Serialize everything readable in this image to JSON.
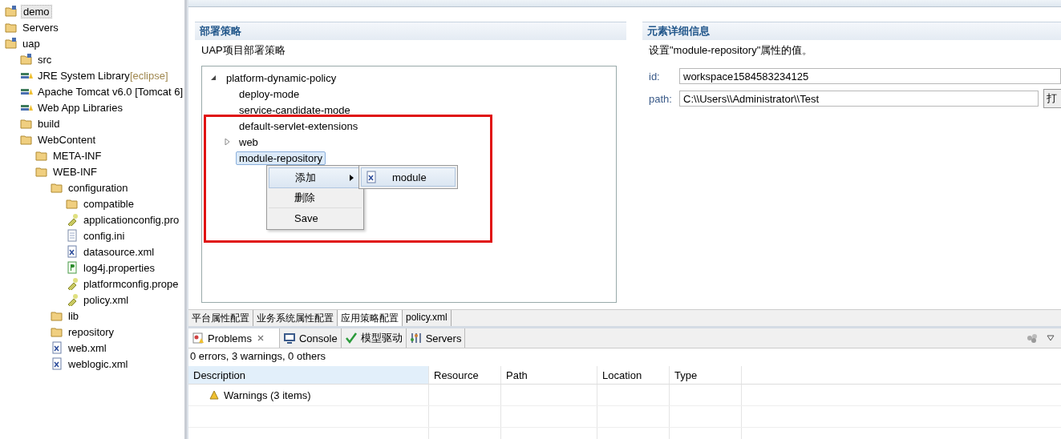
{
  "project_explorer": {
    "items": [
      {
        "label": "demo",
        "kind": "project",
        "selected": true
      },
      {
        "label": "Servers",
        "kind": "folder",
        "selected": false
      },
      {
        "label": "uap",
        "kind": "project",
        "selected": false,
        "children": [
          {
            "label": "src",
            "kind": "package",
            "selected": false
          },
          {
            "label": "JRE System Library",
            "decoration": "[eclipse]",
            "kind": "library",
            "selected": false
          },
          {
            "label": "Apache Tomcat v6.0 [Tomcat 6]",
            "kind": "library",
            "selected": false
          },
          {
            "label": "Web App Libraries",
            "kind": "library",
            "selected": false
          },
          {
            "label": "build",
            "kind": "folder",
            "selected": false
          },
          {
            "label": "WebContent",
            "kind": "folder",
            "selected": false,
            "children": [
              {
                "label": "META-INF",
                "kind": "folder",
                "selected": false
              },
              {
                "label": "WEB-INF",
                "kind": "folder",
                "selected": false,
                "children": [
                  {
                    "label": "configuration",
                    "kind": "folder",
                    "selected": false,
                    "children": [
                      {
                        "label": "compatible",
                        "kind": "folder",
                        "selected": false
                      },
                      {
                        "label": "applicationconfig.pro",
                        "kind": "config",
                        "selected": false
                      },
                      {
                        "label": "config.ini",
                        "kind": "file",
                        "selected": false
                      },
                      {
                        "label": "datasource.xml",
                        "kind": "xml",
                        "selected": false
                      },
                      {
                        "label": "log4j.properties",
                        "kind": "properties",
                        "selected": false
                      },
                      {
                        "label": "platformconfig.prope",
                        "kind": "config",
                        "selected": false
                      },
                      {
                        "label": "policy.xml",
                        "kind": "config",
                        "selected": false
                      }
                    ]
                  },
                  {
                    "label": "lib",
                    "kind": "folder",
                    "selected": false
                  },
                  {
                    "label": "repository",
                    "kind": "folder",
                    "selected": false
                  },
                  {
                    "label": "web.xml",
                    "kind": "xml",
                    "selected": false
                  },
                  {
                    "label": "weblogic.xml",
                    "kind": "xml",
                    "selected": false
                  }
                ]
              }
            ]
          }
        ]
      }
    ]
  },
  "deploy_section": {
    "title": "部署策略",
    "description": "UAP项目部署策略",
    "tree": [
      {
        "label": "platform-dynamic-policy",
        "expanded": true,
        "selected": false,
        "children": [
          {
            "label": "deploy-mode",
            "selected": false
          },
          {
            "label": "service-candidate-mode",
            "selected": false
          },
          {
            "label": "default-servlet-extensions",
            "selected": false
          },
          {
            "label": "web",
            "expanded": false,
            "selected": false
          },
          {
            "label": "module-repository",
            "selected": true
          }
        ]
      }
    ]
  },
  "context_menu": {
    "items": [
      {
        "label": "添加",
        "submenu": true,
        "selected": true
      },
      {
        "label": "删除",
        "submenu": false,
        "selected": false
      },
      {
        "label": "Save",
        "submenu": false,
        "selected": false
      }
    ],
    "submenu": [
      {
        "label": "module"
      }
    ]
  },
  "details_section": {
    "title": "元素详细信息",
    "description": "设置\"module-repository\"属性的值。",
    "fields": [
      {
        "label": "id:",
        "value": "workspace1584583234125"
      },
      {
        "label": "path:",
        "value": "C:\\\\Users\\\\Administrator\\\\Test",
        "button": "打"
      }
    ]
  },
  "editor_tabs": [
    {
      "label": "平台属性配置",
      "selected": false
    },
    {
      "label": "业务系统属性配置",
      "selected": false
    },
    {
      "label": "应用策略配置",
      "selected": true
    },
    {
      "label": "policy.xml",
      "selected": false
    }
  ],
  "view_tabs": [
    {
      "label": "Problems",
      "kind": "problems",
      "selected": true
    },
    {
      "label": "Console",
      "kind": "console",
      "selected": false
    },
    {
      "label": "模型驱动",
      "kind": "check",
      "selected": false
    },
    {
      "label": "Servers",
      "kind": "servers",
      "selected": false
    }
  ],
  "problems": {
    "summary": "0 errors, 3 warnings, 0 others",
    "columns": [
      "Description",
      "Resource",
      "Path",
      "Location",
      "Type"
    ],
    "rows": [
      {
        "description": "Warnings (3 items)"
      }
    ]
  }
}
